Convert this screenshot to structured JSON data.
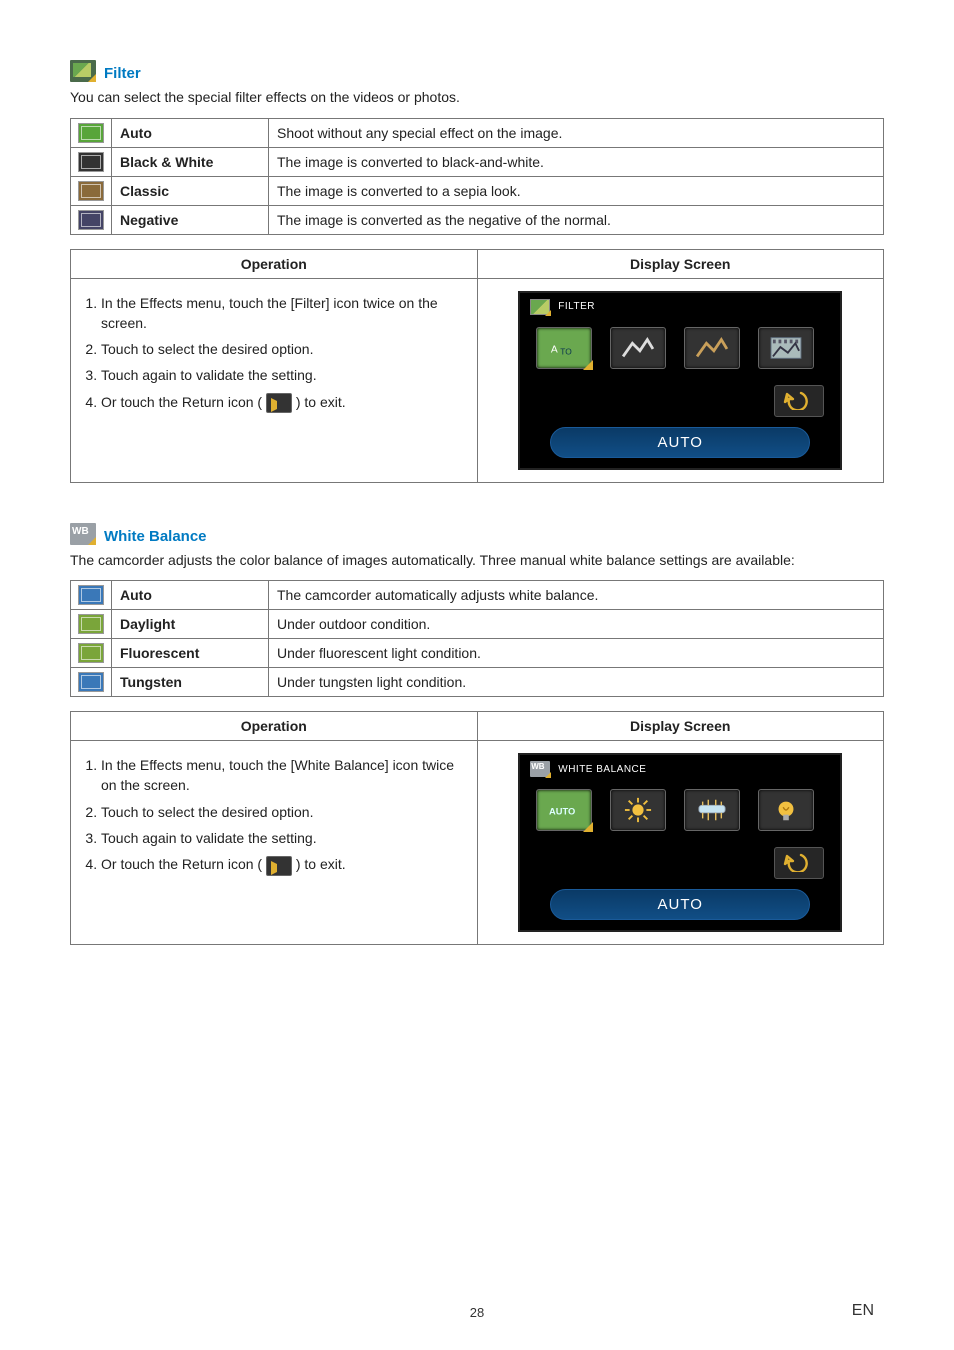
{
  "filter": {
    "title": "Filter",
    "intro": "You can select the special filter effects on the videos or photos.",
    "options": [
      {
        "name": "Auto",
        "desc": "Shoot without any special effect on the image.",
        "icon": "filter-auto-icon"
      },
      {
        "name": "Black & White",
        "desc": "The image is converted to black-and-white.",
        "icon": "filter-bw-icon"
      },
      {
        "name": "Classic",
        "desc": "The image is converted to a sepia look.",
        "icon": "filter-classic-icon"
      },
      {
        "name": "Negative",
        "desc": "The image is converted as the negative of the normal.",
        "icon": "filter-negative-icon"
      }
    ],
    "op_header": "Operation",
    "ds_header": "Display Screen",
    "steps": [
      "In the Effects menu, touch the [Filter] icon twice on the screen.",
      "Touch to select the desired option.",
      "Touch again to validate the setting.",
      "Or touch the Return icon ( __ICON__ ) to exit."
    ],
    "screen": {
      "title": "FILTER",
      "selected_label": "AUTO"
    }
  },
  "wb": {
    "title": "White Balance",
    "intro": "The camcorder adjusts the color balance of images automatically. Three manual white balance settings are available:",
    "options": [
      {
        "name": "Auto",
        "desc": "The camcorder automatically adjusts white balance.",
        "icon": "wb-auto-icon"
      },
      {
        "name": "Daylight",
        "desc": "Under outdoor condition.",
        "icon": "wb-daylight-icon"
      },
      {
        "name": "Fluorescent",
        "desc": "Under fluorescent light condition.",
        "icon": "wb-fluorescent-icon"
      },
      {
        "name": "Tungsten",
        "desc": "Under tungsten light condition.",
        "icon": "wb-tungsten-icon"
      }
    ],
    "op_header": "Operation",
    "ds_header": "Display Screen",
    "steps": [
      "In the Effects menu, touch the [White Balance] icon twice on the screen.",
      "Touch to select the desired option.",
      "Touch again to validate the setting.",
      "Or touch the Return icon ( __ICON__ ) to exit."
    ],
    "screen": {
      "title": "WHITE BALANCE",
      "selected_label": "AUTO"
    }
  },
  "footer": {
    "page": "28",
    "lang": "EN"
  }
}
